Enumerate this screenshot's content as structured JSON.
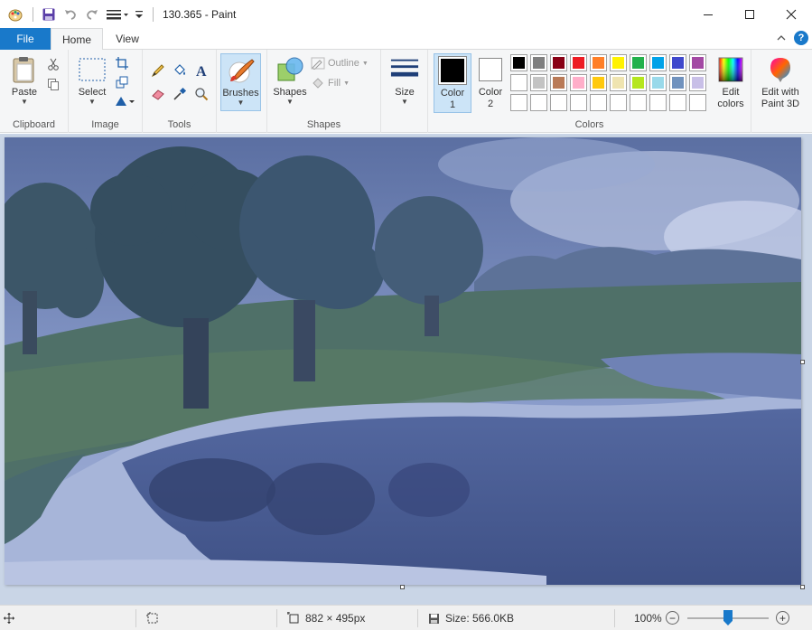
{
  "window": {
    "title": "130.365 - Paint",
    "controls": [
      "minimize",
      "maximize",
      "close"
    ]
  },
  "tabs": {
    "file": "File",
    "home": "Home",
    "view": "View"
  },
  "ribbon": {
    "clipboard": {
      "label": "Clipboard",
      "paste": "Paste"
    },
    "image": {
      "label": "Image",
      "select": "Select"
    },
    "tools": {
      "label": "Tools"
    },
    "brushes": {
      "label": "Brushes"
    },
    "shapes": {
      "label": "Shapes",
      "shapes_btn": "Shapes",
      "outline": "Outline",
      "fill": "Fill"
    },
    "size": {
      "label": "Size"
    },
    "colors": {
      "label": "Colors",
      "color1": "Color",
      "color1_num": "1",
      "color2": "Color",
      "color2_num": "2",
      "edit_colors_1": "Edit",
      "edit_colors_2": "colors",
      "paint3d_1": "Edit with",
      "paint3d_2": "Paint 3D",
      "color1_value": "#000000",
      "color2_value": "#ffffff",
      "palette_row1": [
        "#000000",
        "#7f7f7f",
        "#880015",
        "#ed1c24",
        "#ff7f27",
        "#fff200",
        "#22b14c",
        "#00a2e8",
        "#3f48cc",
        "#a349a4"
      ],
      "palette_row2": [
        "#ffffff",
        "#c3c3c3",
        "#b97a57",
        "#ffaec9",
        "#ffc90e",
        "#efe4b0",
        "#b5e61d",
        "#99d9ea",
        "#7092be",
        "#c8bfe7"
      ],
      "palette_row3": [
        "",
        "",
        "",
        "",
        "",
        "",
        "",
        "",
        "",
        ""
      ]
    }
  },
  "status": {
    "dimensions": "882 × 495px",
    "size": "Size: 566.0KB",
    "zoom": "100%",
    "zoom_value": 100
  }
}
